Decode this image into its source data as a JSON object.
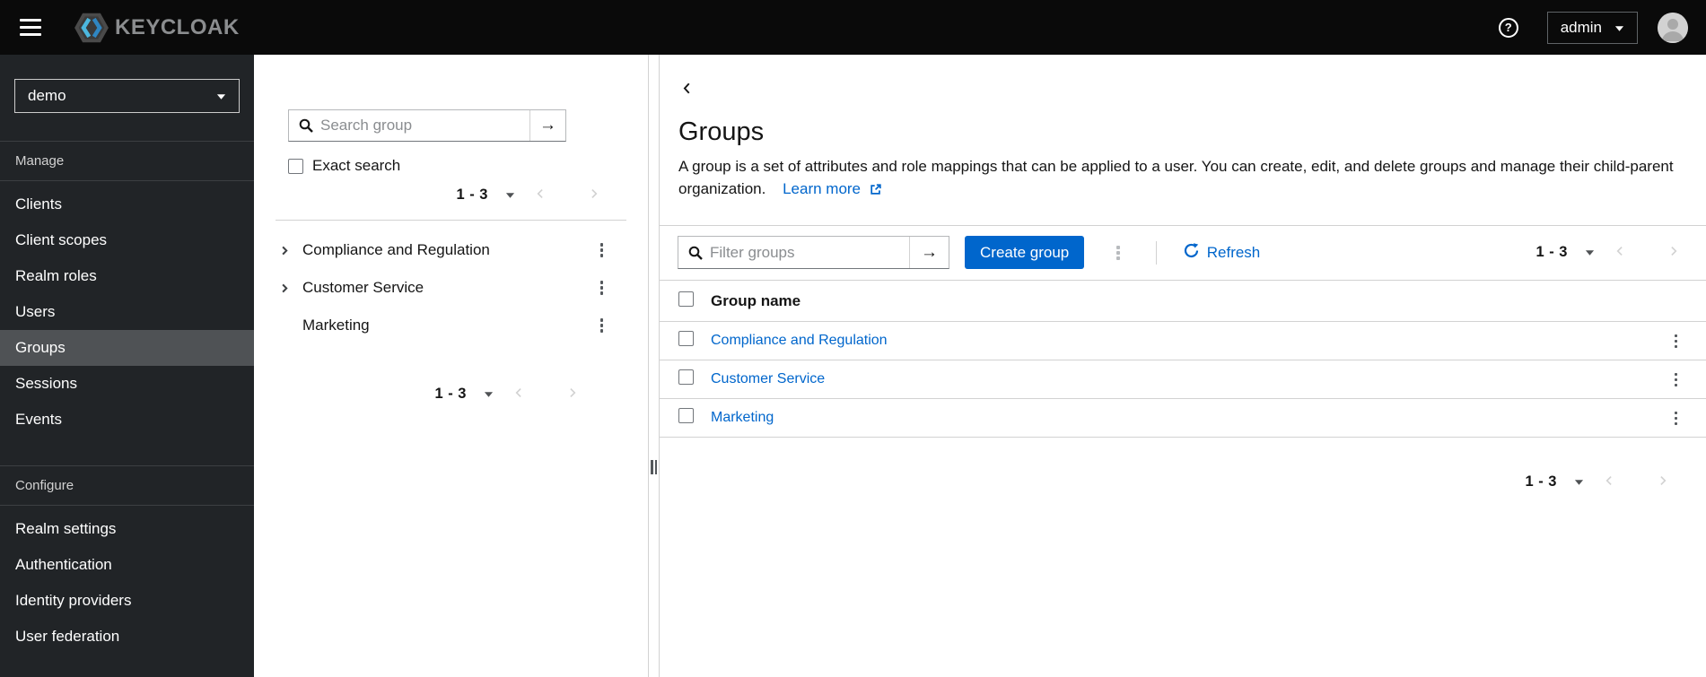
{
  "topbar": {
    "brand": "KEYCLOAK",
    "help_glyph": "?",
    "username": "admin"
  },
  "sidebar": {
    "realm": "demo",
    "sections": [
      {
        "label": "Manage",
        "items": [
          {
            "label": "Clients"
          },
          {
            "label": "Client scopes"
          },
          {
            "label": "Realm roles"
          },
          {
            "label": "Users"
          },
          {
            "label": "Groups",
            "selected": true
          },
          {
            "label": "Sessions"
          },
          {
            "label": "Events"
          }
        ]
      },
      {
        "label": "Configure",
        "items": [
          {
            "label": "Realm settings"
          },
          {
            "label": "Authentication"
          },
          {
            "label": "Identity providers"
          },
          {
            "label": "User federation"
          }
        ]
      }
    ]
  },
  "tree_panel": {
    "search_placeholder": "Search group",
    "exact_search_label": "Exact search",
    "top_pagination": {
      "range": "1 - 3"
    },
    "items": [
      {
        "label": "Compliance and Regulation",
        "expandable": true
      },
      {
        "label": "Customer Service",
        "expandable": true
      },
      {
        "label": "Marketing",
        "expandable": false
      }
    ],
    "bottom_pagination": {
      "range": "1 - 3"
    }
  },
  "main": {
    "title": "Groups",
    "description": "A group is a set of attributes and role mappings that can be applied to a user. You can create, edit, and delete groups and manage their child-parent organization.",
    "learn_more_label": "Learn more",
    "toolbar": {
      "filter_placeholder": "Filter groups",
      "create_button_label": "Create group",
      "refresh_label": "Refresh",
      "pagination": {
        "range": "1 - 3"
      }
    },
    "table": {
      "columns": [
        "Group name"
      ],
      "rows": [
        {
          "name": "Compliance and Regulation"
        },
        {
          "name": "Customer Service"
        },
        {
          "name": "Marketing"
        }
      ]
    },
    "bottom_pagination": {
      "range": "1 - 3"
    }
  },
  "colors": {
    "topbar_bg": "#0a0a0a",
    "sidebar_bg": "#212427",
    "sidebar_selected_bg": "#4f5255",
    "accent_blue": "#0066cc",
    "link_blue": "#0066cc",
    "border_gray": "#d2d2d2"
  }
}
